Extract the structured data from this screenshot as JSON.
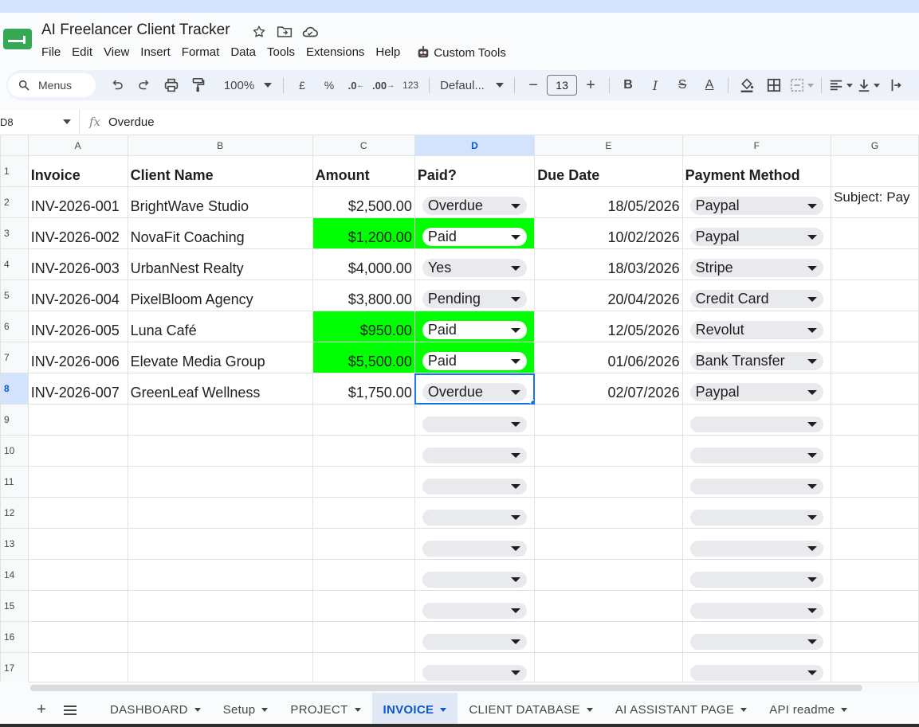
{
  "app": {
    "title": "AI Freelancer Client Tracker",
    "accent": "#0b57d0",
    "brand_color": "#188038"
  },
  "menu": [
    "File",
    "Edit",
    "View",
    "Insert",
    "Format",
    "Data",
    "Tools",
    "Extensions",
    "Help"
  ],
  "custom_menu": "Custom Tools",
  "toolbar": {
    "menus_label": "Menus",
    "zoom": "100%",
    "currency": "£",
    "percent": "%",
    "dec_decrease": ".0",
    "dec_increase": ".00",
    "format_123": "123",
    "font": "Defaul...",
    "font_size": "13"
  },
  "formula": {
    "cell_ref": "D8",
    "value": "Overdue"
  },
  "columns": [
    "A",
    "B",
    "C",
    "D",
    "E",
    "F",
    "G"
  ],
  "selected_column": "D",
  "selected_row": 8,
  "headers": [
    "Invoice",
    "Client Name",
    "Amount",
    "Paid?",
    "Due Date",
    "Payment Method"
  ],
  "rows": [
    {
      "invoice": "INV-2026-001",
      "client": "BrightWave Studio",
      "amount": "$2,500.00",
      "paid": "Overdue",
      "due": "18/05/2026",
      "method": "Paypal",
      "green": false,
      "g": "Subject: Pay"
    },
    {
      "invoice": "INV-2026-002",
      "client": "NovaFit Coaching",
      "amount": "$1,200.00",
      "paid": "Paid",
      "due": "10/02/2026",
      "method": "Paypal",
      "green": true,
      "g": ""
    },
    {
      "invoice": "INV-2026-003",
      "client": "UrbanNest Realty",
      "amount": "$4,000.00",
      "paid": "Yes",
      "due": "18/03/2026",
      "method": "Stripe",
      "green": false,
      "g": ""
    },
    {
      "invoice": "INV-2026-004",
      "client": "PixelBloom Agency",
      "amount": "$3,800.00",
      "paid": "Pending",
      "due": "20/04/2026",
      "method": "Credit Card",
      "green": false,
      "g": ""
    },
    {
      "invoice": "INV-2026-005",
      "client": "Luna Café",
      "amount": "$950.00",
      "paid": "Paid",
      "due": "12/05/2026",
      "method": "Revolut",
      "green": true,
      "g": ""
    },
    {
      "invoice": "INV-2026-006",
      "client": "Elevate Media Group",
      "amount": "$5,500.00",
      "paid": "Paid",
      "due": "01/06/2026",
      "method": "Bank Transfer",
      "green": true,
      "g": ""
    },
    {
      "invoice": "INV-2026-007",
      "client": "GreenLeaf Wellness",
      "amount": "$1,750.00",
      "paid": "Overdue",
      "due": "02/07/2026",
      "method": "Paypal",
      "green": false,
      "g": ""
    }
  ],
  "row_numbers": [
    "1",
    "2",
    "3",
    "4",
    "5",
    "6",
    "7",
    "8",
    "9",
    "10",
    "11",
    "12",
    "13",
    "14",
    "15",
    "16",
    "17"
  ],
  "highlight_color": "#00ff00",
  "tabs": [
    {
      "label": "DASHBOARD",
      "active": false
    },
    {
      "label": "Setup",
      "active": false
    },
    {
      "label": "PROJECT",
      "active": false
    },
    {
      "label": "INVOICE",
      "active": true
    },
    {
      "label": "CLIENT DATABASE",
      "active": false
    },
    {
      "label": "AI ASSISTANT PAGE",
      "active": false
    },
    {
      "label": "API readme",
      "active": false
    }
  ]
}
